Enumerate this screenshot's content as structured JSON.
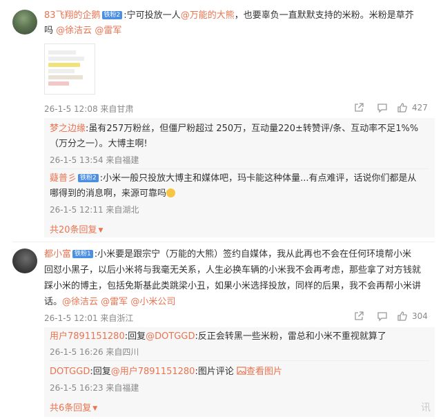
{
  "comments": [
    {
      "username": "83飞翔的企鹅",
      "fan_badge": "铁粉2",
      "text_line1": "宁可投放一人",
      "mention_a": "@万能的大熊",
      "text_line1b": "，也要辜负一直默默支持的米粉。米粉是草芥",
      "text_line2": "吗",
      "mention_b": "@徐洁云",
      "mention_c": "@雷军",
      "meta": "26-1-5 12:08 来自甘肃",
      "like_count": "427",
      "replies": [
        {
          "username": "梦之边缘",
          "text_line1": "虽有257万粉丝，但僵尸粉超过 250万，互动量220±转赞评/条、互动率不足1%%",
          "text_line2": "（万分之一）。大博主啊!",
          "meta": "26-1-5 13:54 来自福建"
        },
        {
          "username": "薿普彡",
          "fan_badge": "铁粉2",
          "text_line1": "小米一般只投放大博主和媒体吧，玛卡能这种体量...有点难评，话说你们都是从",
          "text_line2": "哪得到的消息啊，来源可靠吗",
          "meta": "26-1-5 12:11 来自湖北"
        }
      ],
      "more_replies": "共20条回复"
    },
    {
      "username": "都小富",
      "fan_badge": "铁粉1",
      "text_line1": "小米要是跟宗宁（万能的大熊）签约自媒体，我从此再也不会在任何环境帮小米",
      "text_line2": "回怼小黑子，以后小米将与我毫无关系，人生必换车辆的小米我不会再考虑，那些拿了对方钱就",
      "text_line3": "踩小米的博主，包括免斯基此类跳梁小丑，如果小米选择投放，同样的后果，我不会再帮小米讲",
      "text_line4": "话。",
      "mention_a": "@徐洁云",
      "mention_b": "@雷军",
      "mention_c": "@小米公司",
      "meta": "26-1-5 12:01 来自浙江",
      "like_count": "304",
      "replies": [
        {
          "username": "用户7891151280",
          "reply_word": ":回复",
          "reply_to": "@DOTGGD",
          "text": ":反正会转黑一些米粉，雷总和小米不重视就算了",
          "meta": "26-1-5 16:26 来自四川"
        },
        {
          "username": "DOTGGD",
          "reply_word": ":回复",
          "reply_to": "@用户7891151280",
          "text": ":图片评论",
          "view_image": "查看图片",
          "meta": "26-1-5 16:23 来自福建"
        }
      ],
      "more_replies": "共6条回复"
    }
  ],
  "watermark": "讯"
}
